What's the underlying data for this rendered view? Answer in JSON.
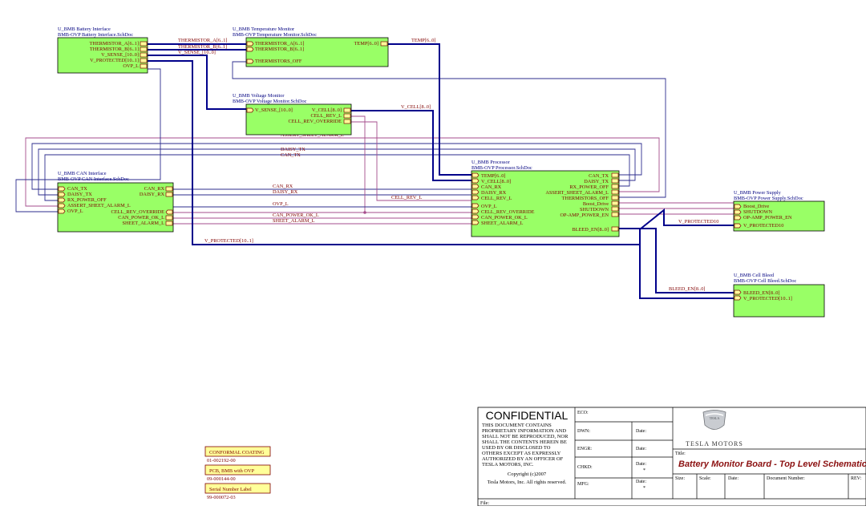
{
  "blocks": {
    "battery": {
      "designator": "U_BMB Battery Interface",
      "file": "BMB-OVP Battery Interface.SchDoc",
      "pins": [
        "THERMISTOR_A[6..1]",
        "THERMISTOR_B[6..1]",
        "V_SENSE_[10..0]",
        "V_PROTECTED[10..1]",
        "OVP_L"
      ]
    },
    "temperature": {
      "designator": "U_BMB Temperature Monitor",
      "file": "BMB-OVP Temperature Monitor.SchDoc",
      "pins_left": [
        "THERMISTOR_A[6..1]",
        "THERMISTOR_B[6..1]",
        "THERMISTORS_OFF"
      ],
      "pins_right": [
        "TEMP[6..0]"
      ]
    },
    "voltage": {
      "designator": "U_BMB Voltage Monitor",
      "file": "BMB-OVP Voltage Monitor.SchDoc",
      "pins_left": [
        "V_SENSE_[10..0]"
      ],
      "pins_right": [
        "V_CELL[8..0]",
        "CELL_REV_L",
        "CELL_REV_OVERRIDE"
      ]
    },
    "can": {
      "designator": "U_BMB CAN Interface",
      "file": "BMB-OVP CAN Interface.SchDoc",
      "pins_left": [
        "CAN_TX",
        "DAISY_TX",
        "RX_POWER_OFF",
        "ASSERT_SHEET_ALARM_L",
        "OVP_L"
      ],
      "pins_right": [
        "CAN_RX",
        "DAISY_RX",
        "CELL_REV_OVERRIDE",
        "CAN_POWER_OK_L",
        "SHEET_ALARM_L"
      ]
    },
    "processor": {
      "designator": "U_BMB Processor",
      "file": "BMB-OVP Processor.SchDoc",
      "pins_left": [
        "TEMP[6..0]",
        "V_CELL[8..0]",
        "CAN_RX",
        "DAISY_RX",
        "CELL_REV_L",
        "OVP_L",
        "CELL_REV_OVERRIDE",
        "CAN_POWER_OK_L",
        "SHEET_ALARM_L"
      ],
      "pins_right": [
        "CAN_TX",
        "DAISY_TX",
        "RX_POWER_OFF",
        "ASSERT_SHEET_ALARM_L",
        "THERMISTORS_OFF",
        "Boost_Drive",
        "SHUTDOWN",
        "OP-AMP_POWER_EN",
        "BLEED_EN[8..0]"
      ]
    },
    "power": {
      "designator": "U_BMB Power Supply",
      "file": "BMB-OVP Power Supply.SchDoc",
      "pins": [
        "Boost_Drive",
        "SHUTDOWN",
        "OP-AMP_POWER_EN",
        "V_PROTECTED10"
      ]
    },
    "bleed": {
      "designator": "U_BMB Cell Bleed",
      "file": "BMB-OVP Cell Bleed.SchDoc",
      "pins": [
        "BLEED_EN[8..0]",
        "V_PROTECTED[10..1]"
      ]
    }
  },
  "nets": {
    "thermistor_a": "THERMISTOR_A[6..1]",
    "thermistor_b": "THERMISTOR_B[6..1]",
    "v_sense": "V_SENSE_[10..0]",
    "temp": "TEMP[6..0]",
    "v_cell": "V_CELL[8..0]",
    "assert_alarm": "ASSERT_SHEET_ALARM_L",
    "daisy_tx": "DAISY_TX",
    "can_tx": "CAN_TX",
    "can_rx": "CAN_RX",
    "daisy_rx": "DAISY_RX",
    "cell_rev": "CELL_REV_L",
    "ovp": "OVP_L",
    "can_power_ok": "CAN_POWER_OK_L",
    "sheet_alarm": "SHEET_ALARM_L",
    "v_protected": "V_PROTECTED[10..1]",
    "v_protected10": "V_PROTECTED10",
    "bleed_en": "BLEED_EN[8..0]"
  },
  "notes": [
    {
      "label": "CONFORMAL COATING",
      "part": "01-002192-00"
    },
    {
      "label": "PCB, BMB with OVP",
      "part": "09-000144-00"
    },
    {
      "label": "Serial Number Label",
      "part": "99-000072-03"
    }
  ],
  "title_block": {
    "confidential": "CONFIDENTIAL",
    "notice": [
      "THIS DOCUMENT CONTAINS",
      "PROPRIETARY INFORMATION AND",
      "SHALL NOT BE REPRODUCED, NOR",
      "SHALL THE CONTENTS HEREIN BE",
      "USED BY OR DISCLOSED TO",
      "OTHERS EXCEPT AS EXPRESSLY",
      "AUTHORIZED BY AN OFFICER OF",
      "TESLA MOTORS, INC."
    ],
    "copyright": "Copyright (c)2007",
    "rights": "Tesla Motors, Inc. All rights reserved.",
    "eco": "ECO:",
    "dwn": "DWN:",
    "engr": "ENGR:",
    "chkd": "CHKD:",
    "mfg": "MFG:",
    "date": "Date:",
    "date_star": "*",
    "brand": "TESLA MOTORS",
    "logo_text": "TESLA",
    "title_label": "Title:",
    "title": "Battery Monitor Board - Top Level Schematic",
    "size": "Size:",
    "scale": "Scale:",
    "date2": "Date:",
    "doc_number": "Document Number:",
    "rev": "REV:",
    "file": "File:"
  }
}
